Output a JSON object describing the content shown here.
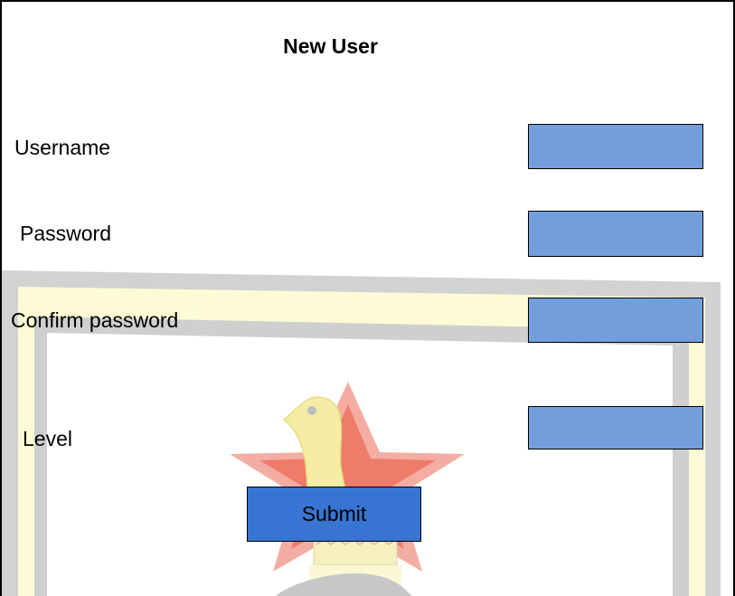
{
  "form": {
    "title": "New User",
    "fields": [
      {
        "label": "Username",
        "value": "",
        "placeholder": ""
      },
      {
        "label": "Password",
        "value": "",
        "placeholder": ""
      },
      {
        "label": "Confirm password",
        "value": "",
        "placeholder": ""
      },
      {
        "label": "Level",
        "value": "",
        "placeholder": ""
      }
    ],
    "submit_label": "Submit"
  },
  "background": {
    "emblem": "zimbabwe-bird-star-emblem-icon",
    "frame_colors": {
      "outer": "#d0d0d0",
      "inner": "#fdfbd6",
      "star": "#e8483a",
      "bird": "#f3ec9a"
    }
  },
  "colors": {
    "field_fill": "#729fdb",
    "button_fill": "#3874d1",
    "border": "#000000"
  }
}
